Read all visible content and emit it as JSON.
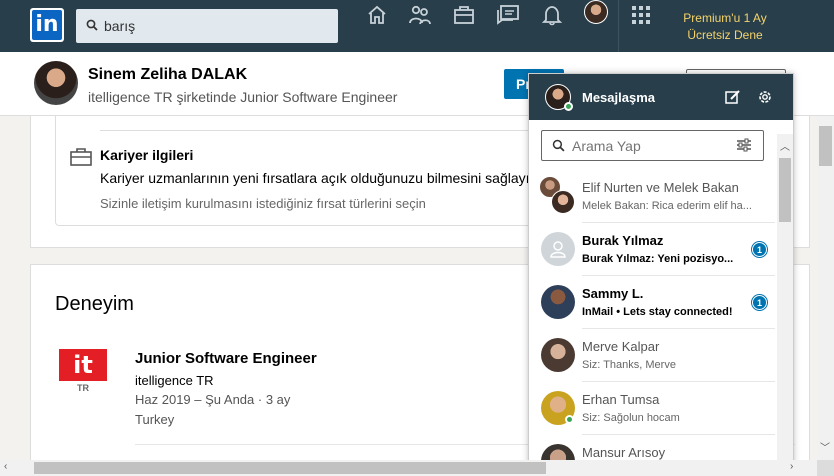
{
  "nav": {
    "logo": "in",
    "search_value": "barış",
    "premium_line1": "Premium'u 1 Ay",
    "premium_line2": "Ücretsiz Dene",
    "icons": [
      "home-icon",
      "network-icon",
      "jobs-icon",
      "messaging-icon",
      "notifications-icon",
      "me-avatar",
      "apps-grid-icon"
    ]
  },
  "profile_header": {
    "name": "Sinem Zeliha DALAK",
    "title": "itelligence TR şirketinde Junior Software Engineer",
    "primary_button_partial": "Pr"
  },
  "career": {
    "title": "Kariyer ilgileri",
    "description": "Kariyer uzmanlarının yeni fırsatlara açık olduğunuzu bilmesini sağlayın;",
    "subtitle": "Sizinle iletişim kurulmasını istediğiniz fırsat türlerini seçin"
  },
  "experience": {
    "heading": "Deneyim",
    "logo_text": "it",
    "logo_sub": "TR",
    "job_title": "Junior Software Engineer",
    "company": "itelligence TR",
    "dates": "Haz 2019 – Şu Anda · 3 ay",
    "location": "Turkey"
  },
  "messaging": {
    "title": "Mesajlaşma",
    "search_placeholder": "Arama Yap",
    "conversations": [
      {
        "name": "Elif Nurten ve Melek Bakan",
        "snippet": "Melek Bakan: Rica ederim elif ha...",
        "unread": false,
        "badge": ""
      },
      {
        "name": "Burak Yılmaz",
        "snippet": "Burak Yılmaz: Yeni pozisyo...",
        "unread": true,
        "badge": "1"
      },
      {
        "name": "Sammy L.",
        "snippet": "InMail • Lets stay connected!",
        "unread": true,
        "badge": "1"
      },
      {
        "name": "Merve Kalpar",
        "snippet": "Siz: Thanks, Merve",
        "unread": false,
        "badge": ""
      },
      {
        "name": "Erhan Tumsa",
        "snippet": "Siz: Sağolun hocam",
        "unread": false,
        "badge": ""
      },
      {
        "name": "Mansur Arısoy",
        "snippet": "",
        "unread": false,
        "badge": ""
      }
    ]
  },
  "colors": {
    "nav_bg": "#283e4a",
    "brand_blue": "#0073b1",
    "premium_gold": "#f5d36c",
    "company_red": "#e31e24",
    "online_green": "#3aa655"
  }
}
